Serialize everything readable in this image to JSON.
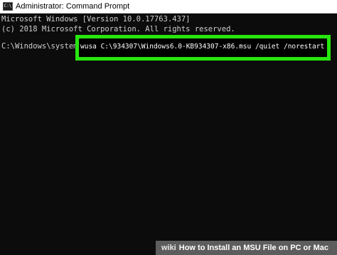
{
  "window": {
    "title": "Administrator: Command Prompt",
    "icon": "C:\\"
  },
  "console": {
    "line1": "Microsoft Windows [Version 10.0.17763.437]",
    "line2": "(c) 2018 Microsoft Corporation. All rights reserved.",
    "prompt": "C:\\Windows\\system32>",
    "command": "wusa C:\\934307\\Windows6.0-KB934307-x86.msu /quiet /norestart"
  },
  "watermark": {
    "brand": "wiki",
    "text": "How to Install an MSU File on PC or Mac"
  },
  "colors": {
    "console_bg": "#0c0c0c",
    "console_text": "#cfcfcf",
    "highlight_border": "#27e60f"
  }
}
